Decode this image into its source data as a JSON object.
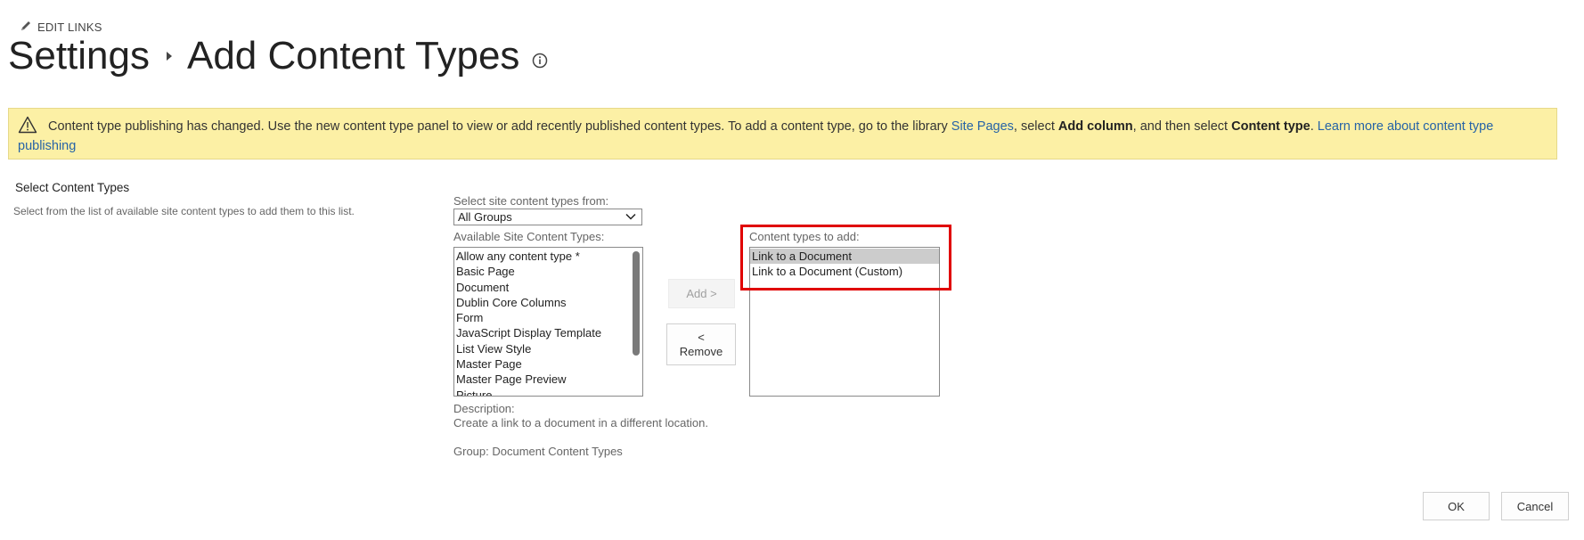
{
  "header": {
    "edit_links": "EDIT LINKS",
    "breadcrumb_parent": "Settings",
    "page_title": "Add Content Types"
  },
  "banner": {
    "text_1": "Content type publishing has changed. Use the new content type panel to view or add recently published content types. To add a content type, go to the library ",
    "link_site_pages": "Site Pages",
    "text_2": ", select ",
    "bold_add_column": "Add column",
    "text_3": ", and then select ",
    "bold_content_type": "Content type",
    "text_4": ". ",
    "link_learn_more": "Learn more about content type publishing",
    "background_color": "#fcf0a5",
    "link_color": "#2663a6"
  },
  "section": {
    "title": "Select Content Types",
    "description": "Select from the list of available site content types to add them to this list."
  },
  "selector": {
    "group_label": "Select site content types from:",
    "group_value": "All Groups",
    "available_label": "Available Site Content Types:",
    "available_items": [
      "Allow any content type *",
      "Basic Page",
      "Document",
      "Dublin Core Columns",
      "Form",
      "JavaScript Display Template",
      "List View Style",
      "Master Page",
      "Master Page Preview",
      "Picture"
    ],
    "add_button": "Add >",
    "remove_button_line1": "<",
    "remove_button_line2": "Remove",
    "to_add_label": "Content types to add:",
    "to_add_items": [
      "Link to a Document",
      "Link to a Document (Custom)"
    ],
    "highlight_color": "#e00000"
  },
  "details": {
    "description_label": "Description:",
    "description_text": "Create a link to a document in a different location.",
    "group_text": "Group: Document Content Types"
  },
  "footer": {
    "ok_button": "OK",
    "cancel_button": "Cancel"
  }
}
